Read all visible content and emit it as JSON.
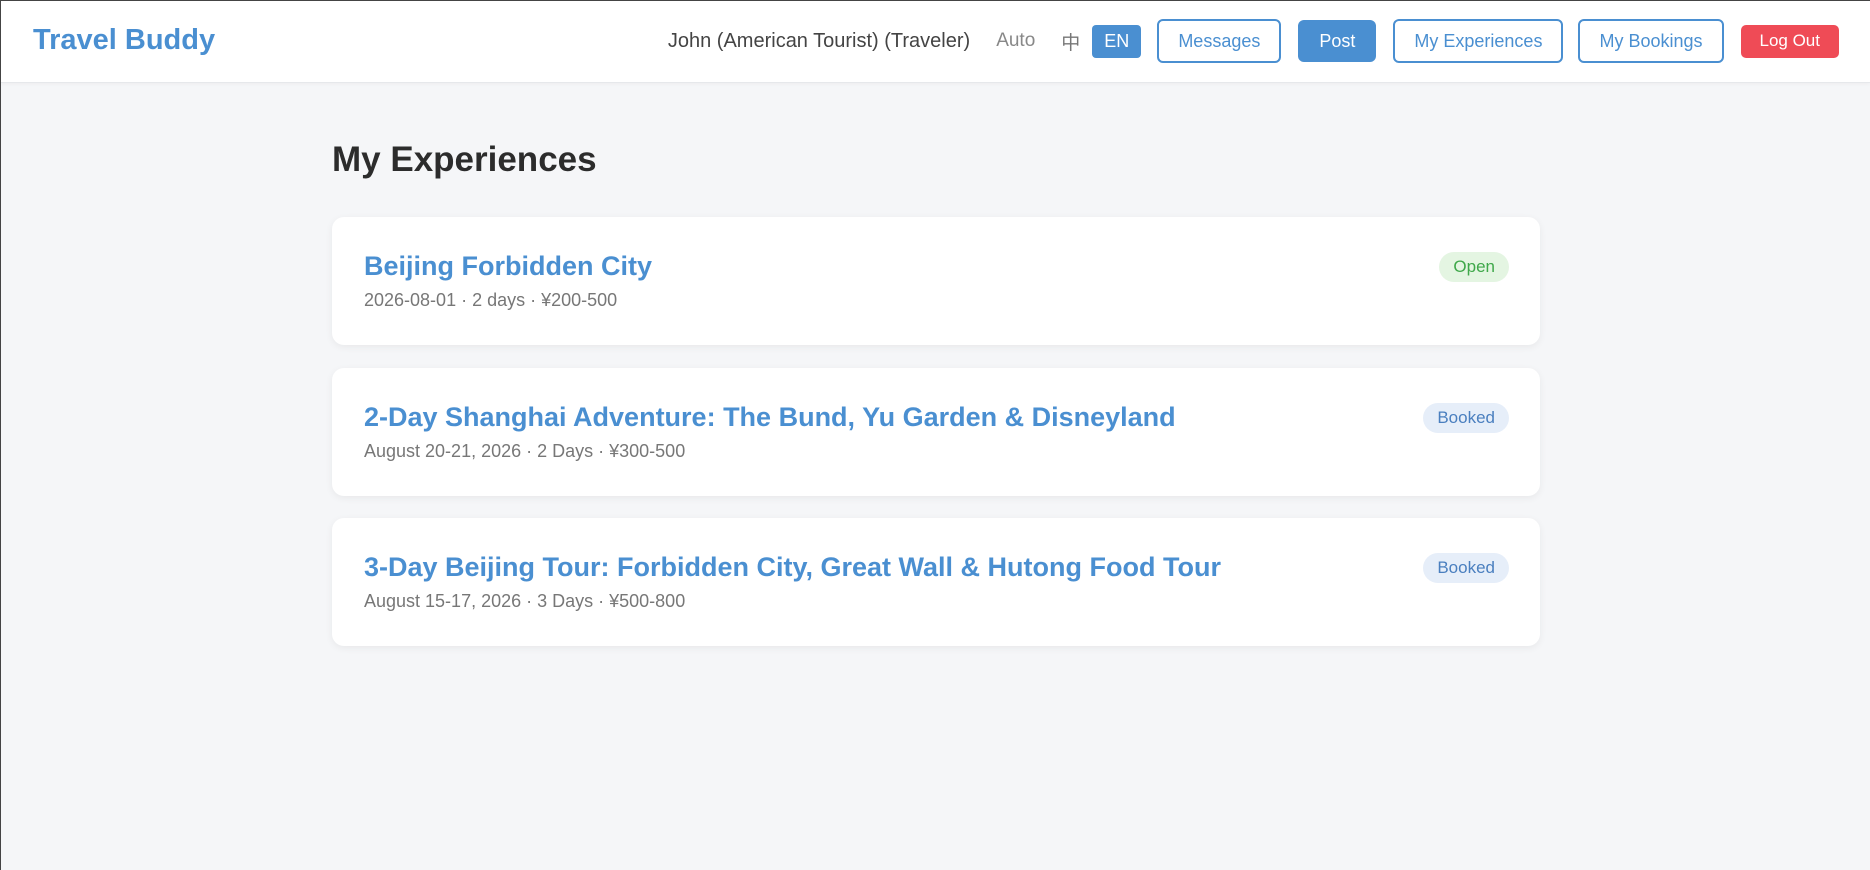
{
  "header": {
    "brand": "Travel Buddy",
    "user": "John (American Tourist) (Traveler)",
    "theme_label": "Auto",
    "lang_zh": "中",
    "lang_en": "EN",
    "messages_label": "Messages",
    "post_label": "Post",
    "my_experiences_label": "My Experiences",
    "my_bookings_label": "My Bookings",
    "logout_label": "Log Out"
  },
  "main": {
    "title": "My Experiences",
    "experiences": [
      {
        "title": "Beijing Forbidden City",
        "meta": "2026-08-01 · 2 days · ¥200-500",
        "status": "Open"
      },
      {
        "title": "2-Day Shanghai Adventure: The Bund, Yu Garden & Disneyland",
        "meta": "August 20-21, 2026 · 2 Days · ¥300-500",
        "status": "Booked"
      },
      {
        "title": "3-Day Beijing Tour: Forbidden City, Great Wall & Hutong Food Tour",
        "meta": "August 15-17, 2026 · 3 Days · ¥500-800",
        "status": "Booked"
      }
    ]
  },
  "colors": {
    "accent": "#4a8fd1",
    "danger": "#ef4b56",
    "status_open": "#3fa84a",
    "status_booked": "#4a7fbf",
    "background": "#f5f6f8"
  }
}
